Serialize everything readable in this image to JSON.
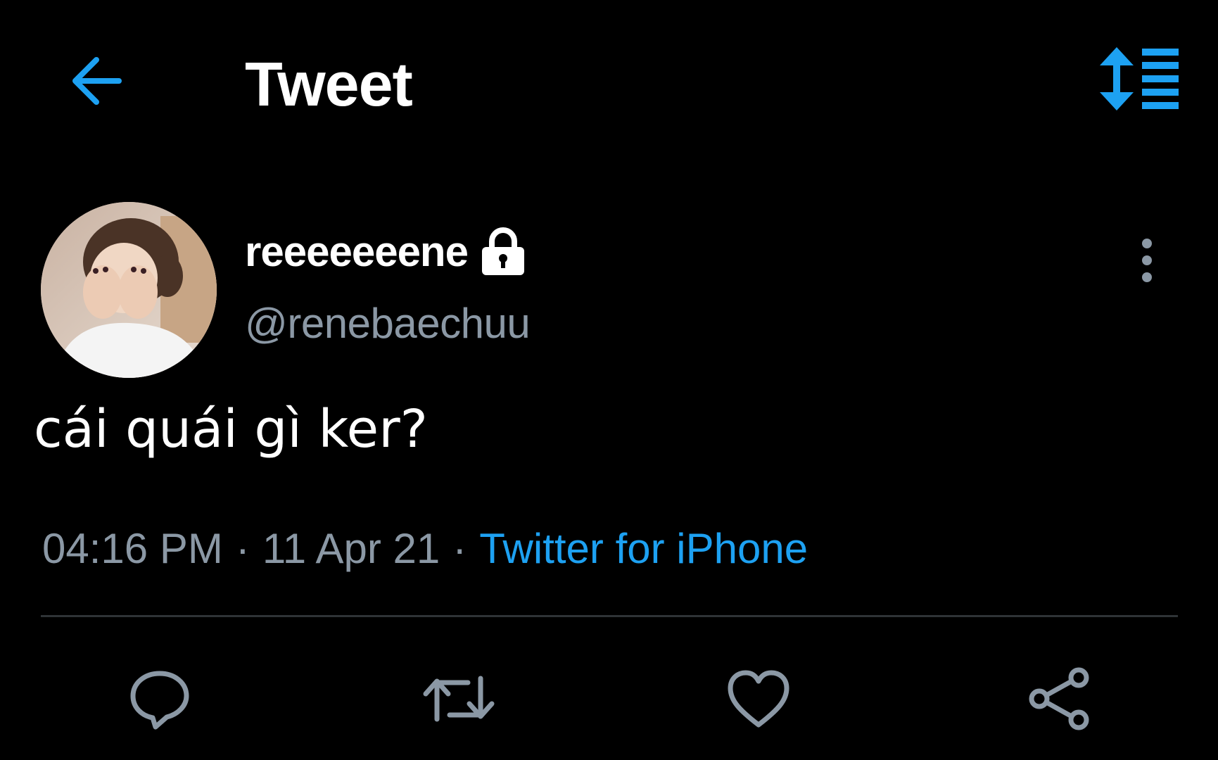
{
  "header": {
    "back_icon": "arrow-left-icon",
    "title": "Tweet",
    "sort_icon": "sort-list-icon"
  },
  "tweet": {
    "author": {
      "name": "reeeeeeene",
      "handle": "@renebaechuu",
      "protected_icon": "lock-icon",
      "avatar_icon": "avatar-photo"
    },
    "more_icon": "more-vertical-icon",
    "text": "cái quái gì ker?",
    "meta": {
      "time": "04:16 PM",
      "separator": "·",
      "date": "11 Apr 21",
      "source": "Twitter for iPhone"
    },
    "actions": {
      "reply_icon": "reply-icon",
      "retweet_icon": "retweet-icon",
      "like_icon": "heart-icon",
      "share_icon": "share-icon"
    }
  },
  "colors": {
    "background": "#000000",
    "accent": "#1da1f2",
    "text_primary": "#ffffff",
    "text_secondary": "#8b98a5",
    "divider": "#2f3336"
  }
}
